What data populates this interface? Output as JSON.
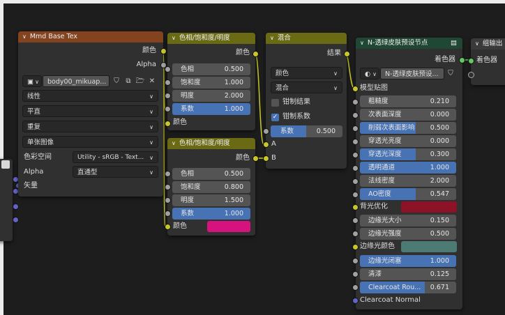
{
  "nodes": {
    "tex": {
      "title": "Mmd Base Tex",
      "out_color": "颜色",
      "out_alpha": "Alpha",
      "image_name": "body00_mikuap...",
      "interpolation": "线性",
      "projection": "平直",
      "extension": "重复",
      "source": "单张图像",
      "colorspace_label": "色彩空间",
      "colorspace_value": "Utility - sRGB - Text...",
      "alpha_label": "Alpha",
      "alpha_value": "直通型",
      "in_vector": "矢量"
    },
    "hsv1": {
      "title": "色相/饱和度/明度",
      "out": "颜色",
      "hue_label": "色相",
      "hue_value": "0.500",
      "sat_label": "饱和度",
      "sat_value": "1.000",
      "val_label": "明度",
      "val_value": "2.000",
      "fac_label": "系数",
      "fac_value": "1.000",
      "in_color": "颜色"
    },
    "hsv2": {
      "title": "色相/饱和度/明度",
      "out": "颜色",
      "hue_label": "色相",
      "hue_value": "0.500",
      "sat_label": "饱和度",
      "sat_value": "0.800",
      "val_label": "明度",
      "val_value": "1.500",
      "fac_label": "系数",
      "fac_value": "1.000",
      "in_color": "颜色",
      "color_swatch": "#d4137f"
    },
    "mix": {
      "title": "混合",
      "out": "结果",
      "data_type": "颜色",
      "blend_mode": "混合",
      "clamp_result": "钳制结果",
      "clamp_factor": "钳制系数",
      "fac_label": "系数",
      "fac_value": "0.500",
      "in_a": "A",
      "in_b": "B"
    },
    "group": {
      "title": "N-透绿皮肤预设节点",
      "out": "着色器",
      "preset_name": "N-透绿皮肤预设...",
      "in_model_tex": "模型贴图",
      "rows": [
        {
          "label": "粗糙度",
          "value": "0.210",
          "hl": false
        },
        {
          "label": "次表面深度",
          "value": "0.000",
          "hl": false
        },
        {
          "label": "削弱次表面影响",
          "value": "0.500",
          "hl": true
        },
        {
          "label": "穿透光亮度",
          "value": "0.000",
          "hl": false
        },
        {
          "label": "穿透光深度",
          "value": "0.300",
          "hl": true
        },
        {
          "label": "透明通道",
          "value": "1.000",
          "hl": true,
          "full": true
        },
        {
          "label": "法线密度",
          "value": "2.000",
          "hl": false
        },
        {
          "label": "AO密度",
          "value": "0.547",
          "hl": true
        }
      ],
      "backlight_label": "背光优化",
      "backlight_color": "#8c1327",
      "rim_size_label": "边缘光大小",
      "rim_size_value": "0.150",
      "rim_strength_label": "边缘光强度",
      "rim_strength_value": "0.500",
      "rim_color_label": "边缘光颜色",
      "rim_color": "#4e7a74",
      "rim_occ_label": "边缘光闭塞",
      "rim_occ_value": "1.000",
      "clearcoat_label": "清漆",
      "clearcoat_value": "0.125",
      "clearcoat_rough_label": "Clearcoat Rou...",
      "clearcoat_rough_value": "0.671",
      "clearcoat_normal_label": "Clearcoat Normal"
    },
    "output": {
      "title": "组输出",
      "in_shader": "着色器"
    }
  },
  "colors": {
    "tex_header": "#83431e",
    "hsv_header": "#6a6a14",
    "mix_header": "#6a6a14",
    "group_header": "#204733",
    "output_header": "#3a3a3a",
    "link_color": "#c7c729"
  }
}
